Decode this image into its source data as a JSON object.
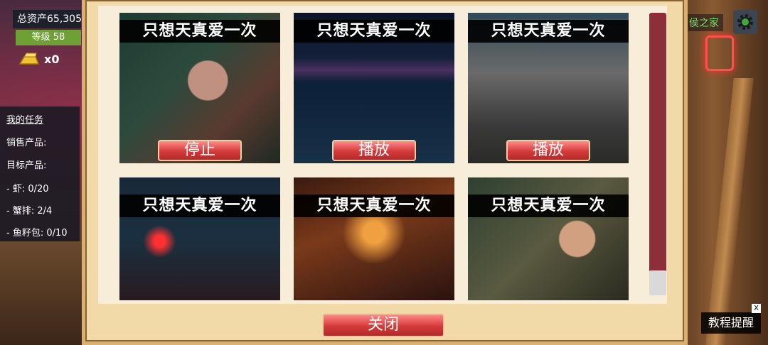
{
  "hud": {
    "total_assets": "总资产65,305",
    "level": "等级 58",
    "gold_count": "x0",
    "home_label": "侯之家"
  },
  "tasks": {
    "title": "我的任务",
    "sell_label": "销售产品:",
    "target_label": "目标产品:",
    "items": [
      "- 虾: 0/20",
      "- 蟹排: 2/4",
      "- 鱼籽包: 0/10"
    ]
  },
  "songs": [
    {
      "title": "只想天真爱一次",
      "button": "停止"
    },
    {
      "title": "只想天真爱一次",
      "button": "播放"
    },
    {
      "title": "只想天真爱一次",
      "button": "播放"
    },
    {
      "title": "只想天真爱一次"
    },
    {
      "title": "只想天真爱一次"
    },
    {
      "title": "只想天真爱一次"
    }
  ],
  "modal": {
    "close_label": "关闭"
  },
  "tutorial": {
    "label": "教程提醒",
    "close": "X"
  },
  "colors": {
    "button_red": "#d63a3a",
    "scroll_track": "#8d2f38",
    "level_green": "#6fa035",
    "panel_cream": "#f8edd8"
  }
}
